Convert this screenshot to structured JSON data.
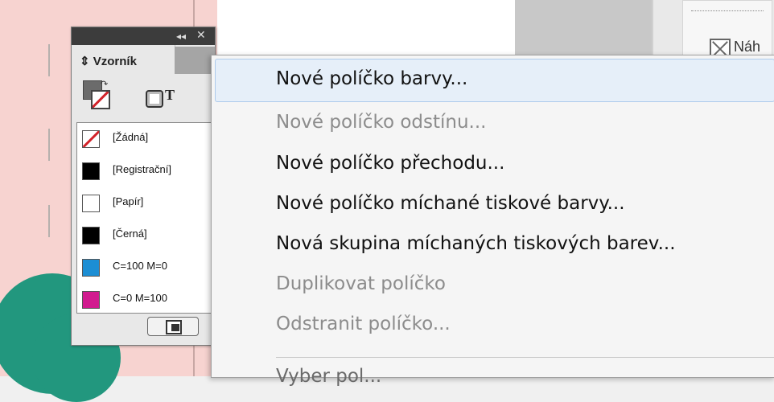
{
  "swatches_panel": {
    "title": "Vzorník",
    "swatches": [
      {
        "name": "[Žádná]",
        "color": "none"
      },
      {
        "name": "[Registrační]",
        "color": "#000000"
      },
      {
        "name": "[Papír]",
        "color": "#ffffff"
      },
      {
        "name": "[Černá]",
        "color": "#000000"
      },
      {
        "name": "C=100 M=0",
        "color": "#1c8ed4"
      },
      {
        "name": "C=0 M=100",
        "color": "#d11b8f"
      }
    ]
  },
  "context_menu": {
    "items": [
      {
        "label": "Nové políčko barvy...",
        "enabled": true,
        "highlighted": true
      },
      {
        "label": "Nové políčko odstínu...",
        "enabled": false
      },
      {
        "label": "Nové políčko přechodu...",
        "enabled": true
      },
      {
        "label": "Nové políčko míchané tiskové barvy...",
        "enabled": true
      },
      {
        "label": "Nová skupina míchaných tiskových barev...",
        "enabled": true
      },
      {
        "label": "Duplikovat políčko",
        "enabled": false
      },
      {
        "label": "Odstranit políčko...",
        "enabled": false
      },
      {
        "label": "Vyber pol...",
        "enabled": true
      }
    ]
  },
  "background_panel": {
    "partial_label": "Náh"
  },
  "colors": {
    "page_pink": "#f7d3d0",
    "teal": "#22977e",
    "highlight": "#e6eff9"
  }
}
